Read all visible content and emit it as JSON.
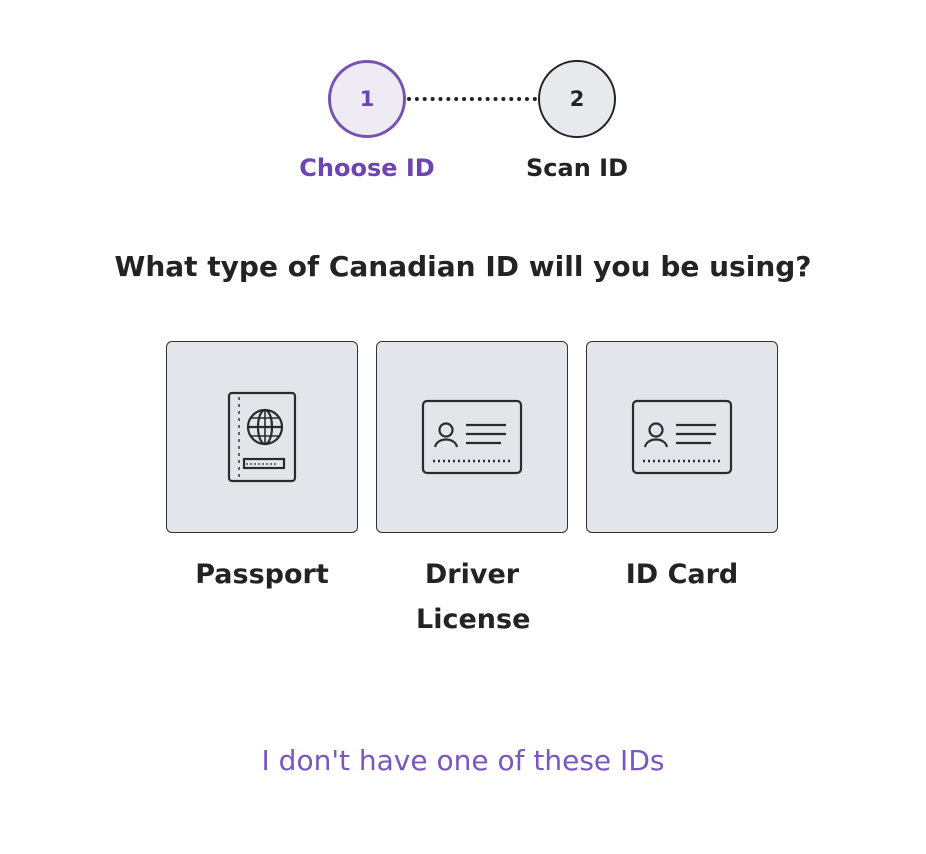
{
  "stepper": {
    "steps": [
      {
        "number": "1",
        "label": "Choose ID",
        "state": "active"
      },
      {
        "number": "2",
        "label": "Scan ID",
        "state": "inactive"
      }
    ]
  },
  "question": "What type of Canadian ID will you be using?",
  "options": [
    {
      "label": "Passport",
      "icon": "passport-icon"
    },
    {
      "label": "Driver License",
      "icon": "id-card-icon"
    },
    {
      "label": "ID Card",
      "icon": "id-card-icon"
    }
  ],
  "alt_link": "I don't have one of these IDs",
  "colors": {
    "accent": "#6c45b0",
    "text": "#232323",
    "card_bg": "#e3e5ea",
    "inactive_step_bg": "#e8e9ed"
  }
}
